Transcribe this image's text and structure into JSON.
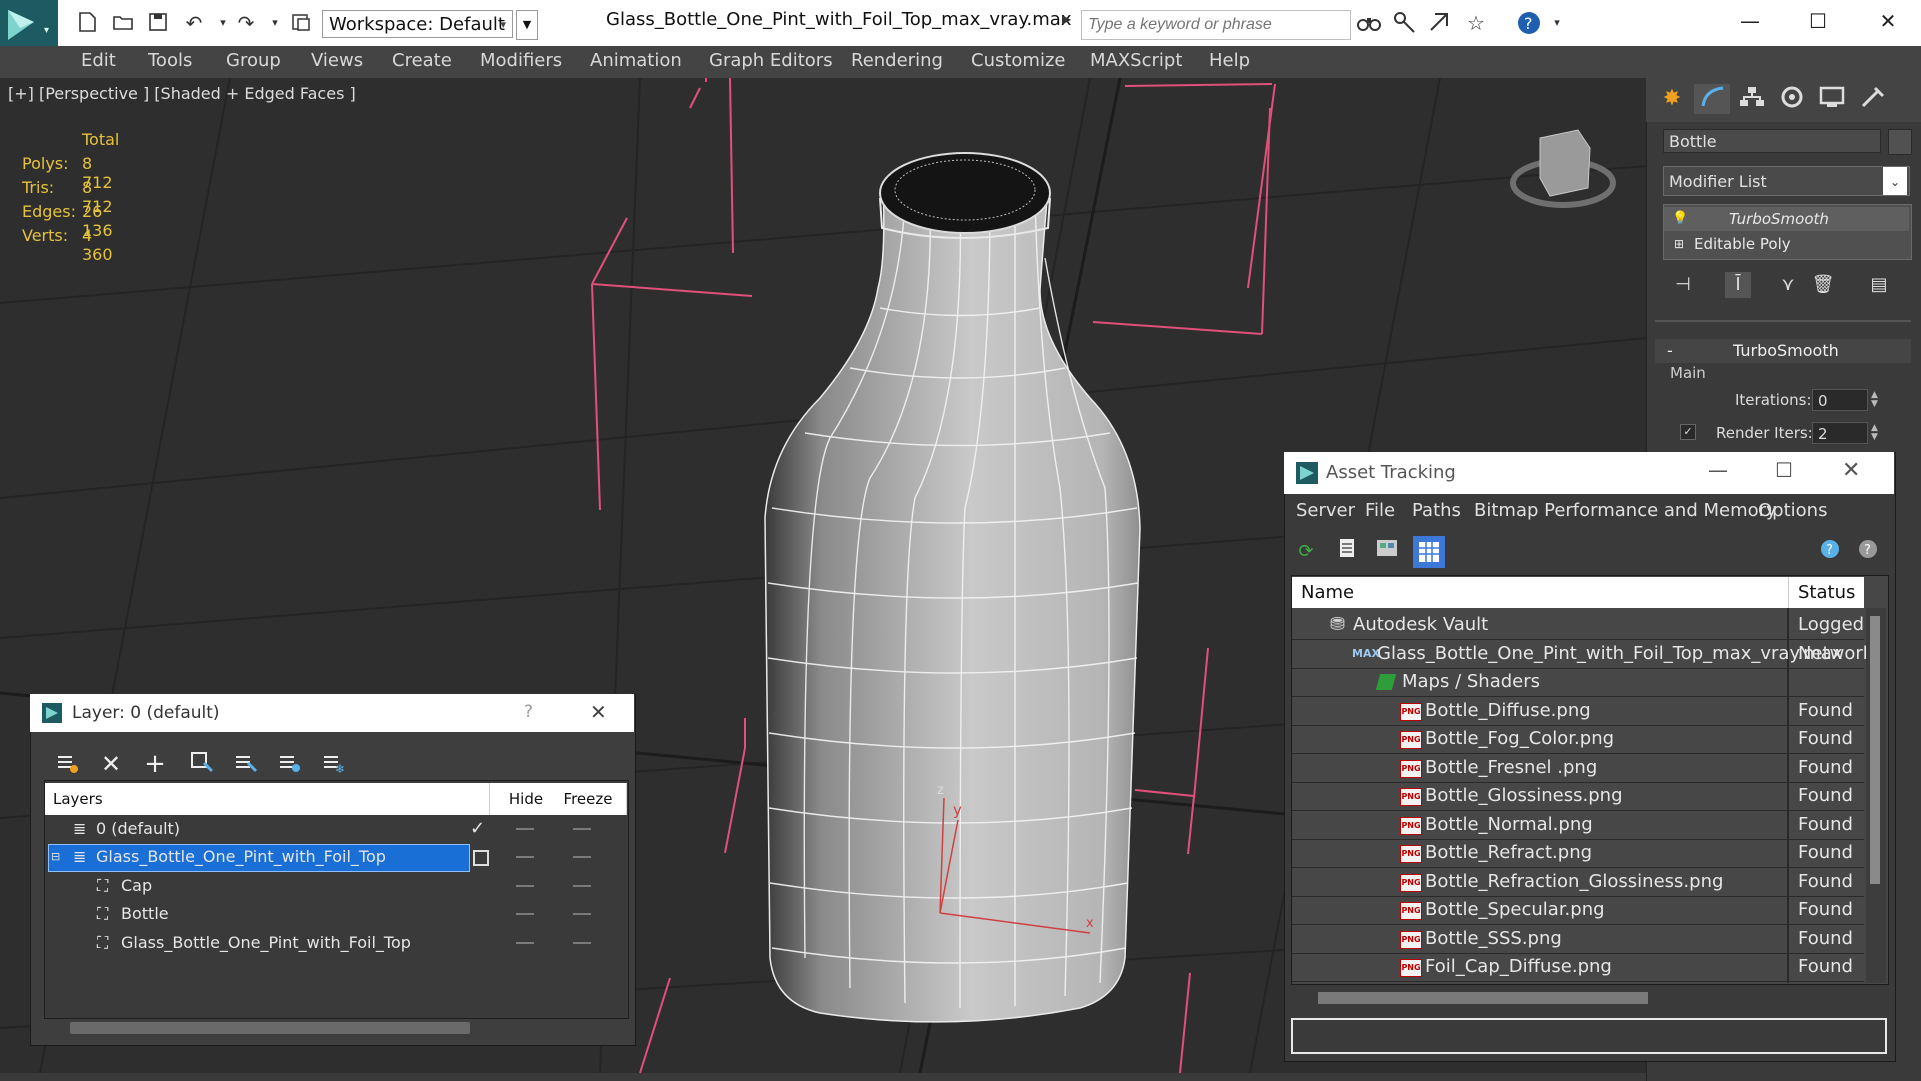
{
  "titlebar": {
    "workspace": "Workspace: Default",
    "document_title": "Glass_Bottle_One_Pint_with_Foil_Top_max_vray.max",
    "search_placeholder": "Type a keyword or phrase"
  },
  "menu": [
    "Edit",
    "Tools",
    "Group",
    "Views",
    "Create",
    "Modifiers",
    "Animation",
    "Graph Editors",
    "Rendering",
    "Customize",
    "MAXScript",
    "Help"
  ],
  "viewport": {
    "label": "[+] [Perspective ] [Shaded + Edged Faces ]",
    "stats_header": "Total",
    "stats": [
      {
        "label": "Polys:",
        "value": "8 712"
      },
      {
        "label": "Tris:",
        "value": "8 712"
      },
      {
        "label": "Edges:",
        "value": "26 136"
      },
      {
        "label": "Verts:",
        "value": "4 360"
      }
    ],
    "gizmo": {
      "z": "z",
      "y": "y",
      "x": "x"
    }
  },
  "command_panel": {
    "object_name": "Bottle",
    "modifier_list": "Modifier List",
    "stack": [
      "TurboSmooth",
      "Editable Poly"
    ],
    "rollout_title": "TurboSmooth",
    "group": "Main",
    "iterations_label": "Iterations:",
    "iterations_value": "0",
    "render_iters_label": "Render Iters:",
    "render_iters_value": "2",
    "rollout_toggle": "-"
  },
  "layer_dialog": {
    "title": "Layer: 0 (default)",
    "help": "?",
    "columns": {
      "layers": "Layers",
      "hide": "Hide",
      "freeze": "Freeze"
    },
    "rows": [
      {
        "name": "0 (default)",
        "indent": 0
      },
      {
        "name": "Glass_Bottle_One_Pint_with_Foil_Top",
        "indent": 0,
        "selected": true
      },
      {
        "name": "Cap",
        "indent": 1
      },
      {
        "name": "Bottle",
        "indent": 1
      },
      {
        "name": "Glass_Bottle_One_Pint_with_Foil_Top",
        "indent": 1
      }
    ]
  },
  "asset_tracking": {
    "title": "Asset Tracking",
    "menu": [
      "Server",
      "File",
      "Paths",
      "Bitmap Performance and Memory",
      "Options"
    ],
    "columns": {
      "name": "Name",
      "status": "Status"
    },
    "rows": [
      {
        "name": "Autodesk Vault",
        "status": "Logged",
        "level": 1,
        "icon": "vault-icon"
      },
      {
        "name": "Glass_Bottle_One_Pint_with_Foil_Top_max_vray.max",
        "status": "Network",
        "level": 2,
        "icon": "max-file-icon"
      },
      {
        "name": "Maps / Shaders",
        "status": "",
        "level": 3,
        "icon": "maps-folder-icon"
      },
      {
        "name": "Bottle_Diffuse.png",
        "status": "Found",
        "level": 4,
        "icon": "png-icon"
      },
      {
        "name": "Bottle_Fog_Color.png",
        "status": "Found",
        "level": 4,
        "icon": "png-icon"
      },
      {
        "name": "Bottle_Fresnel .png",
        "status": "Found",
        "level": 4,
        "icon": "png-icon"
      },
      {
        "name": "Bottle_Glossiness.png",
        "status": "Found",
        "level": 4,
        "icon": "png-icon"
      },
      {
        "name": "Bottle_Normal.png",
        "status": "Found",
        "level": 4,
        "icon": "png-icon"
      },
      {
        "name": "Bottle_Refract.png",
        "status": "Found",
        "level": 4,
        "icon": "png-icon"
      },
      {
        "name": "Bottle_Refraction_Glossiness.png",
        "status": "Found",
        "level": 4,
        "icon": "png-icon"
      },
      {
        "name": "Bottle_Specular.png",
        "status": "Found",
        "level": 4,
        "icon": "png-icon"
      },
      {
        "name": "Bottle_SSS.png",
        "status": "Found",
        "level": 4,
        "icon": "png-icon"
      },
      {
        "name": "Foil_Cap_Diffuse.png",
        "status": "Found",
        "level": 4,
        "icon": "png-icon"
      }
    ]
  },
  "colors": {
    "accent": "#0078d7",
    "stats": "#e5c23b",
    "selection_box": "#e0507a",
    "viewport_bg": "#2e2e2e"
  }
}
